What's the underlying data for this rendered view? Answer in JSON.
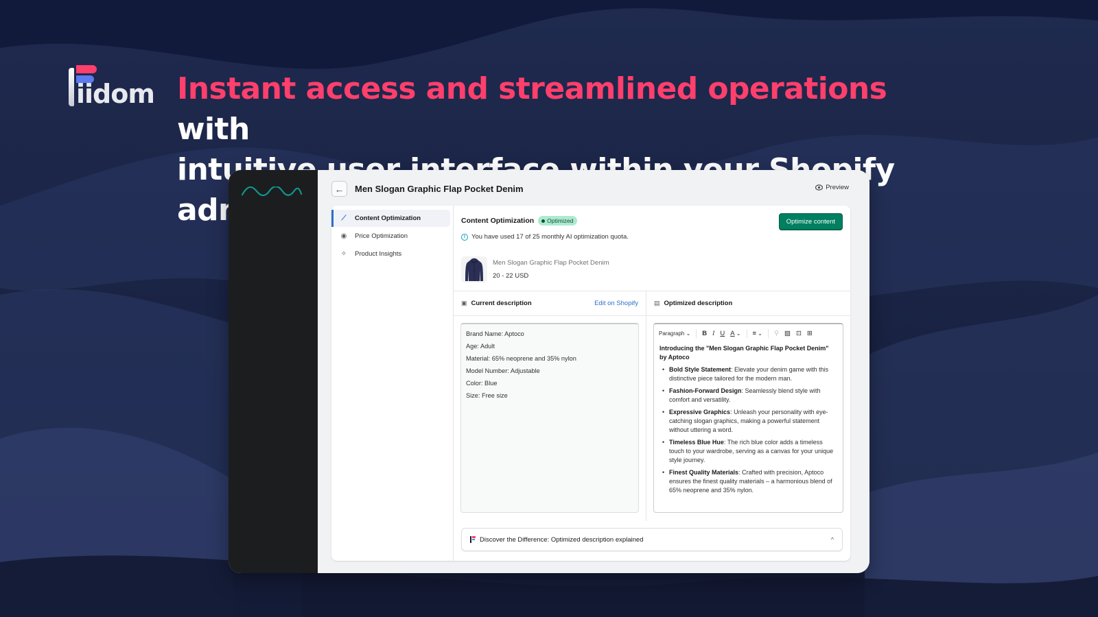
{
  "brand": {
    "name": "iidom"
  },
  "headline": {
    "accent": "Instant access and streamlined operations",
    "rest_line1": " with",
    "line2": "intuitive user interface within your Shopify admin"
  },
  "colors": {
    "accent_pink": "#ff3f6c",
    "primary_green": "#008060",
    "link_blue": "#2c6ecb",
    "bg_navy": "#17203f"
  },
  "app": {
    "header": {
      "back_icon": "arrow-left-icon",
      "title": "Men Slogan Graphic Flap Pocket Denim",
      "preview_label": "Preview",
      "preview_icon": "eye-icon"
    },
    "nav": {
      "items": [
        {
          "label": "Content Optimization",
          "icon": "magic-wand-icon",
          "active": true
        },
        {
          "label": "Price Optimization",
          "icon": "price-tag-icon",
          "active": false
        },
        {
          "label": "Product Insights",
          "icon": "sparkle-insights-icon",
          "active": false
        }
      ]
    },
    "content": {
      "section_title": "Content Optimization",
      "status_badge": "Optimized",
      "optimize_button": "Optimize content",
      "quota_text": "You have used 17 of 25 monthly AI optimization quota.",
      "product": {
        "name": "Men Slogan Graphic Flap Pocket Denim",
        "price": "20 - 22 USD"
      },
      "current_description": {
        "header": "Current description",
        "edit_link": "Edit on Shopify",
        "lines": [
          "Brand Name: Aptoco",
          "Age: Adult",
          "Material: 65% neoprene and 35% nylon",
          "Model Number: Adjustable",
          "Color: Blue",
          "Size: Free size"
        ]
      },
      "optimized_description": {
        "header": "Optimized description",
        "toolbar": {
          "format_select": "Paragraph",
          "bold": "B",
          "italic": "I",
          "underline": "U",
          "text_color": "A"
        },
        "intro": "Introducing the \"Men Slogan Graphic Flap Pocket Denim\" by Aptoco",
        "bullets": [
          {
            "title": "Bold Style Statement",
            "text": ": Elevate your denim game with this distinctive piece tailored for the modern man."
          },
          {
            "title": "Fashion-Forward Design",
            "text": ": Seamlessly blend style with comfort and versatility."
          },
          {
            "title": "Expressive Graphics",
            "text": ": Unleash your personality with eye-catching slogan graphics, making a powerful statement without uttering a word."
          },
          {
            "title": "Timeless Blue Hue",
            "text": ": The rich blue color adds a timeless touch to your wardrobe, serving as a canvas for your unique style journey."
          },
          {
            "title": "Finest Quality Materials",
            "text": ": Crafted with precision, Aptoco ensures the finest quality materials – a harmonious blend of 65% neoprene and 35% nylon."
          }
        ]
      },
      "explain_panel": {
        "label": "Discover the Difference: Optimized description explained",
        "expanded": true
      }
    }
  }
}
